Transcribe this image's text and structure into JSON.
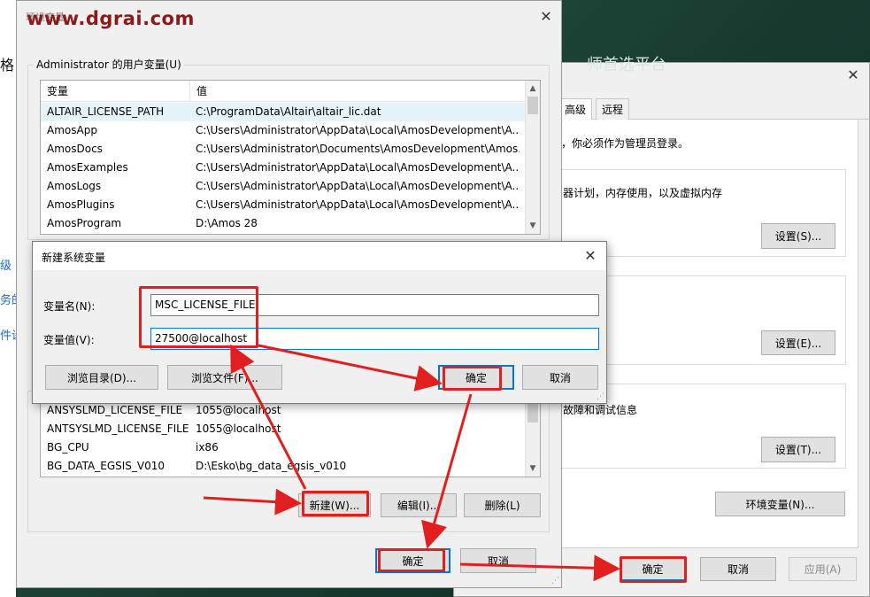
{
  "watermark": "www.dgrai.com",
  "side_fragments": [
    "格",
    "级",
    "务的",
    "件设"
  ],
  "sysprops": {
    "tabs": [
      {
        "label": "高级"
      },
      {
        "label": "远程"
      }
    ],
    "admin_note": "，你必须作为管理员登录。",
    "performance_desc": "器计划，内存使用，以及虚拟内存",
    "settings1_label": "设置(S)...",
    "settings2_label": "设置(E)...",
    "startup_desc": "故障和调试信息",
    "settings3_label": "设置(T)...",
    "envvars_button_label": "环境变量(N)...",
    "ok_label": "确定",
    "cancel_label": "取消",
    "apply_label": "应用(A)",
    "bg_heading_fragment": "师首选平台"
  },
  "envvars": {
    "title_ghost": "环境变量",
    "user_section_label": "Administrator 的用户变量(U)",
    "columns": {
      "variable": "变量",
      "value": "值"
    },
    "user_vars": [
      {
        "name": "ALTAIR_LICENSE_PATH",
        "value": "C:\\ProgramData\\Altair\\altair_lic.dat"
      },
      {
        "name": "AmosApp",
        "value": "C:\\Users\\Administrator\\AppData\\Local\\AmosDevelopment\\A..."
      },
      {
        "name": "AmosDocs",
        "value": "C:\\Users\\Administrator\\Documents\\AmosDevelopment\\Amos..."
      },
      {
        "name": "AmosExamples",
        "value": "C:\\Users\\Administrator\\AppData\\Local\\AmosDevelopment\\A..."
      },
      {
        "name": "AmosLogs",
        "value": "C:\\Users\\Administrator\\AppData\\Local\\AmosDevelopment\\A..."
      },
      {
        "name": "AmosPlugins",
        "value": "C:\\Users\\Administrator\\AppData\\Local\\AmosDevelopment\\A..."
      },
      {
        "name": "AmosProgram",
        "value": "D:\\Amos 28"
      }
    ],
    "system_vars": [
      {
        "name": "ANSYSLMD_LICENSE_FILE",
        "value": "1055@localhost"
      },
      {
        "name": "ANTSYSLMD_LICENSE_FILE",
        "value": "1055@localhost"
      },
      {
        "name": "BG_CPU",
        "value": "ix86"
      },
      {
        "name": "BG_DATA_EGSIS_V010",
        "value": "D:\\Esko\\bg_data_egsis_v010"
      }
    ],
    "new_label": "新建(W)...",
    "edit_label": "编辑(I)...",
    "delete_label": "删除(L)",
    "ok_label": "确定",
    "cancel_label": "取消"
  },
  "newvar": {
    "title": "新建系统变量",
    "name_label": "变量名(N):",
    "value_label": "变量值(V):",
    "name_value": "MSC_LICENSE_FILE",
    "value_value": "27500@localhost",
    "browse_dir_label": "浏览目录(D)...",
    "browse_file_label": "浏览文件(F)...",
    "ok_label": "确定",
    "cancel_label": "取消"
  },
  "annotation_color": "#e21f1f"
}
